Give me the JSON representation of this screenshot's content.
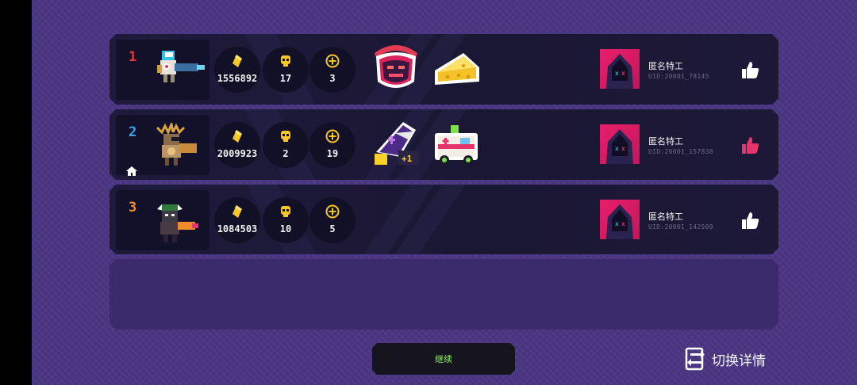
{
  "colors": {
    "rank1": "#e8333b",
    "rank2": "#38a8ee",
    "rank3": "#f0912b",
    "like_active": "#e8336b",
    "like_inactive": "#ffffff",
    "continue_text": "#8ff26b",
    "coin": "#f7c72a"
  },
  "players": [
    {
      "rank": "1",
      "is_self": false,
      "hero_icon": "knight-gunner-hero-icon",
      "coins": "1556892",
      "kills": "17",
      "plus_count": "3",
      "items": [
        "demon-mask-icon",
        "cheese-icon"
      ],
      "name": "匿名特工",
      "uid": "UID:20001_78145",
      "liked": false
    },
    {
      "rank": "2",
      "is_self": true,
      "hero_icon": "antler-hero-icon",
      "coins": "2009923",
      "kills": "2",
      "plus_count": "19",
      "items": [
        "shark-wizard-plus-one-icon",
        "ambulance-icon"
      ],
      "name": "匿名特工",
      "uid": "UID:20001_157838",
      "liked": true
    },
    {
      "rank": "3",
      "is_self": false,
      "hero_icon": "viking-hero-icon",
      "coins": "1084503",
      "kills": "10",
      "plus_count": "5",
      "items": [],
      "name": "匿名特工",
      "uid": "UID:20001_142509",
      "liked": false
    }
  ],
  "footer": {
    "continue_label": "继续",
    "switch_detail_label": "切换详情"
  }
}
